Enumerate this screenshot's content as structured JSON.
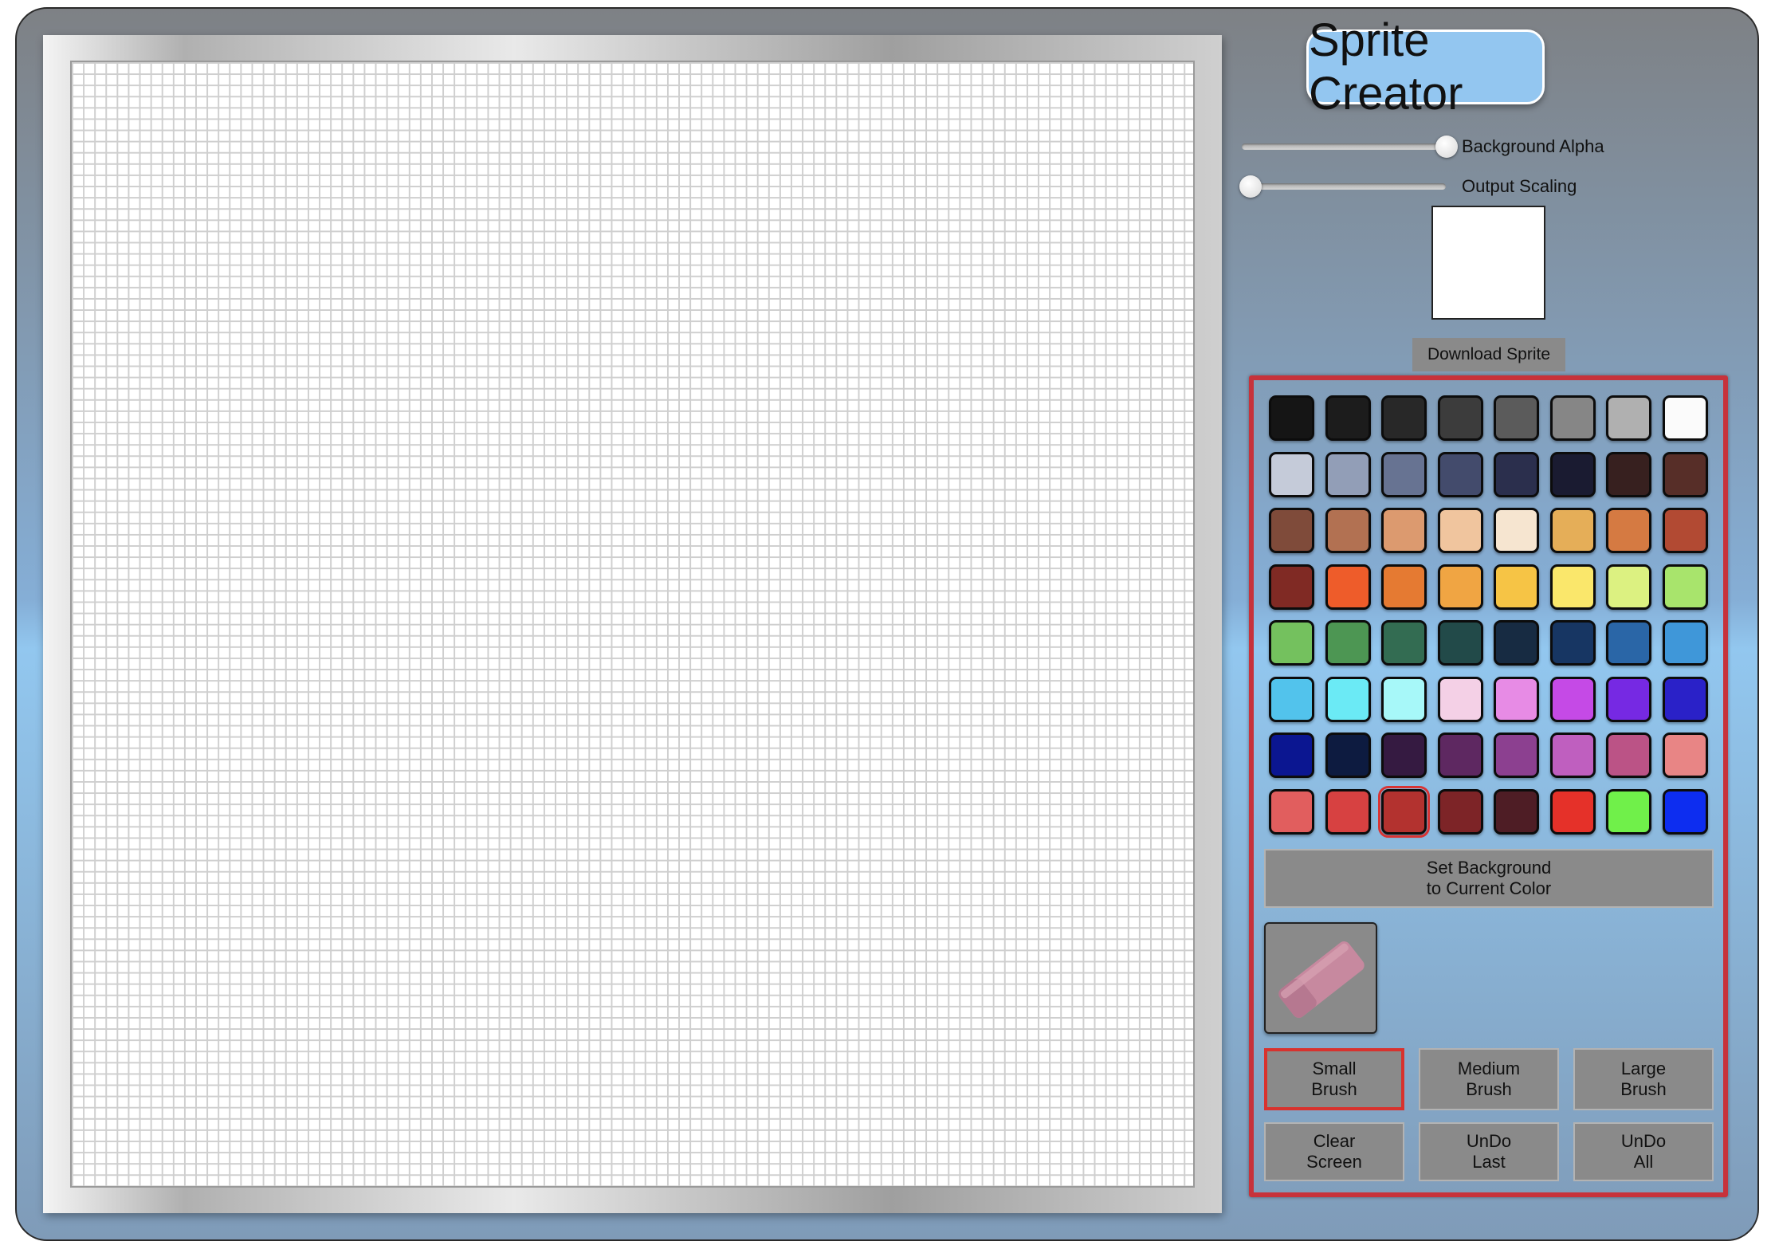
{
  "app": {
    "title": "Sprite Creator"
  },
  "sliders": [
    {
      "id": "background-alpha",
      "label": "Background Alpha",
      "value": 1.0
    },
    {
      "id": "output-scaling",
      "label": "Output Scaling",
      "value": 0.0
    }
  ],
  "download": {
    "label": "Download Sprite"
  },
  "palette": {
    "selected_index": 58,
    "colors": [
      "#151515",
      "#1c1c1c",
      "#282828",
      "#3c3c3c",
      "#5b5b5b",
      "#868686",
      "#b0b0b0",
      "#fbfbfb",
      "#c5cbd9",
      "#929eb7",
      "#677392",
      "#434b6c",
      "#2b2f4d",
      "#1a1b31",
      "#37201f",
      "#572e28",
      "#7f4b3a",
      "#b27152",
      "#dc9a6f",
      "#f0c59e",
      "#f6e5d0",
      "#e5ae58",
      "#d57a42",
      "#b24a33",
      "#802a24",
      "#ee5c2a",
      "#e57a32",
      "#f0a543",
      "#f6c445",
      "#fae76b",
      "#dcf181",
      "#a8e46c",
      "#74c15e",
      "#4d9653",
      "#336c52",
      "#224a49",
      "#172b42",
      "#173663",
      "#2a66a7",
      "#3f97d9",
      "#52c3ec",
      "#6beaf5",
      "#a7f8f9",
      "#f4d0e6",
      "#e78be5",
      "#c54ae6",
      "#7629e3",
      "#2a21c8",
      "#0b1691",
      "#0d1b40",
      "#351a41",
      "#5e2861",
      "#8c4090",
      "#bf5fbf",
      "#bb5386",
      "#e88585",
      "#e15e5e",
      "#d74141",
      "#b3322f",
      "#7d2427",
      "#4e1d25",
      "#e53129",
      "#70f04a",
      "#0d2df0"
    ]
  },
  "buttons": {
    "set_background": "Set Background\nto Current Color",
    "small_brush": "Small\nBrush",
    "medium_brush": "Medium\nBrush",
    "large_brush": "Large\nBrush",
    "clear_screen": "Clear\nScreen",
    "undo_last": "UnDo\nLast",
    "undo_all": "UnDo\nAll"
  },
  "brush": {
    "active": "small"
  },
  "eraser": {
    "icon": "eraser-icon"
  }
}
